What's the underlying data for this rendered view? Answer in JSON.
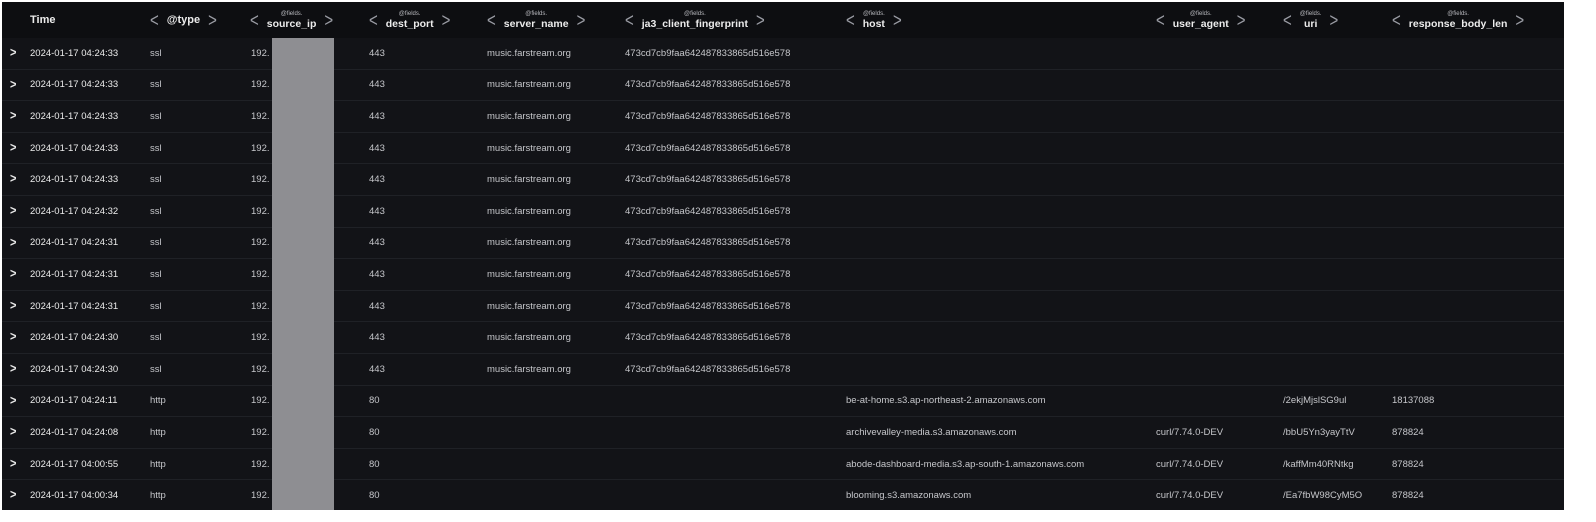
{
  "columns": [
    {
      "prefix": "",
      "name": "Time",
      "chevrons": false
    },
    {
      "prefix": "",
      "name": "@type",
      "chevrons": true
    },
    {
      "prefix": "@fields.",
      "name": "source_ip",
      "chevrons": true
    },
    {
      "prefix": "@fields.",
      "name": "dest_port",
      "chevrons": true
    },
    {
      "prefix": "@fields.",
      "name": "server_name",
      "chevrons": true
    },
    {
      "prefix": "@fields.",
      "name": "ja3_client_fingerprint",
      "chevrons": true
    },
    {
      "prefix": "@fields.",
      "name": "host",
      "chevrons": true
    },
    {
      "prefix": "@fields.",
      "name": "user_agent",
      "chevrons": true
    },
    {
      "prefix": "@fields.",
      "name": "uri",
      "chevrons": true
    },
    {
      "prefix": "@fields.",
      "name": "response_body_len",
      "chevrons": true
    }
  ],
  "rows": [
    {
      "time": "2024-01-17 04:24:33",
      "type": "ssl",
      "source_ip": "192.",
      "dest_port": "443",
      "server_name": "music.farstream.org",
      "ja3": "473cd7cb9faa642487833865d516e578",
      "host": "",
      "user_agent": "",
      "uri": "",
      "response_body_len": ""
    },
    {
      "time": "2024-01-17 04:24:33",
      "type": "ssl",
      "source_ip": "192.",
      "dest_port": "443",
      "server_name": "music.farstream.org",
      "ja3": "473cd7cb9faa642487833865d516e578",
      "host": "",
      "user_agent": "",
      "uri": "",
      "response_body_len": ""
    },
    {
      "time": "2024-01-17 04:24:33",
      "type": "ssl",
      "source_ip": "192.",
      "dest_port": "443",
      "server_name": "music.farstream.org",
      "ja3": "473cd7cb9faa642487833865d516e578",
      "host": "",
      "user_agent": "",
      "uri": "",
      "response_body_len": ""
    },
    {
      "time": "2024-01-17 04:24:33",
      "type": "ssl",
      "source_ip": "192.",
      "dest_port": "443",
      "server_name": "music.farstream.org",
      "ja3": "473cd7cb9faa642487833865d516e578",
      "host": "",
      "user_agent": "",
      "uri": "",
      "response_body_len": ""
    },
    {
      "time": "2024-01-17 04:24:33",
      "type": "ssl",
      "source_ip": "192.",
      "dest_port": "443",
      "server_name": "music.farstream.org",
      "ja3": "473cd7cb9faa642487833865d516e578",
      "host": "",
      "user_agent": "",
      "uri": "",
      "response_body_len": ""
    },
    {
      "time": "2024-01-17 04:24:32",
      "type": "ssl",
      "source_ip": "192.",
      "dest_port": "443",
      "server_name": "music.farstream.org",
      "ja3": "473cd7cb9faa642487833865d516e578",
      "host": "",
      "user_agent": "",
      "uri": "",
      "response_body_len": ""
    },
    {
      "time": "2024-01-17 04:24:31",
      "type": "ssl",
      "source_ip": "192.",
      "dest_port": "443",
      "server_name": "music.farstream.org",
      "ja3": "473cd7cb9faa642487833865d516e578",
      "host": "",
      "user_agent": "",
      "uri": "",
      "response_body_len": ""
    },
    {
      "time": "2024-01-17 04:24:31",
      "type": "ssl",
      "source_ip": "192.",
      "dest_port": "443",
      "server_name": "music.farstream.org",
      "ja3": "473cd7cb9faa642487833865d516e578",
      "host": "",
      "user_agent": "",
      "uri": "",
      "response_body_len": ""
    },
    {
      "time": "2024-01-17 04:24:31",
      "type": "ssl",
      "source_ip": "192.",
      "dest_port": "443",
      "server_name": "music.farstream.org",
      "ja3": "473cd7cb9faa642487833865d516e578",
      "host": "",
      "user_agent": "",
      "uri": "",
      "response_body_len": ""
    },
    {
      "time": "2024-01-17 04:24:30",
      "type": "ssl",
      "source_ip": "192.",
      "dest_port": "443",
      "server_name": "music.farstream.org",
      "ja3": "473cd7cb9faa642487833865d516e578",
      "host": "",
      "user_agent": "",
      "uri": "",
      "response_body_len": ""
    },
    {
      "time": "2024-01-17 04:24:30",
      "type": "ssl",
      "source_ip": "192.",
      "dest_port": "443",
      "server_name": "music.farstream.org",
      "ja3": "473cd7cb9faa642487833865d516e578",
      "host": "",
      "user_agent": "",
      "uri": "",
      "response_body_len": ""
    },
    {
      "time": "2024-01-17 04:24:11",
      "type": "http",
      "source_ip": "192.",
      "dest_port": "80",
      "server_name": "",
      "ja3": "",
      "host": "be-at-home.s3.ap-northeast-2.amazonaws.com",
      "user_agent": "",
      "uri": "/2ekjMjslSG9ul",
      "response_body_len": "18137088"
    },
    {
      "time": "2024-01-17 04:24:08",
      "type": "http",
      "source_ip": "192.",
      "dest_port": "80",
      "server_name": "",
      "ja3": "",
      "host": "archivevalley-media.s3.amazonaws.com",
      "user_agent": "curl/7.74.0-DEV",
      "uri": "/bbU5Yn3yayTtV",
      "response_body_len": "878824"
    },
    {
      "time": "2024-01-17 04:00:55",
      "type": "http",
      "source_ip": "192.",
      "dest_port": "80",
      "server_name": "",
      "ja3": "",
      "host": "abode-dashboard-media.s3.ap-south-1.amazonaws.com",
      "user_agent": "curl/7.74.0-DEV",
      "uri": "/kaffMm40RNtkg",
      "response_body_len": "878824"
    },
    {
      "time": "2024-01-17 04:00:34",
      "type": "http",
      "source_ip": "192.",
      "dest_port": "80",
      "server_name": "",
      "ja3": "",
      "host": "blooming.s3.amazonaws.com",
      "user_agent": "curl/7.74.0-DEV",
      "uri": "/Ea7fbW98CyM5O",
      "response_body_len": "878824"
    }
  ]
}
